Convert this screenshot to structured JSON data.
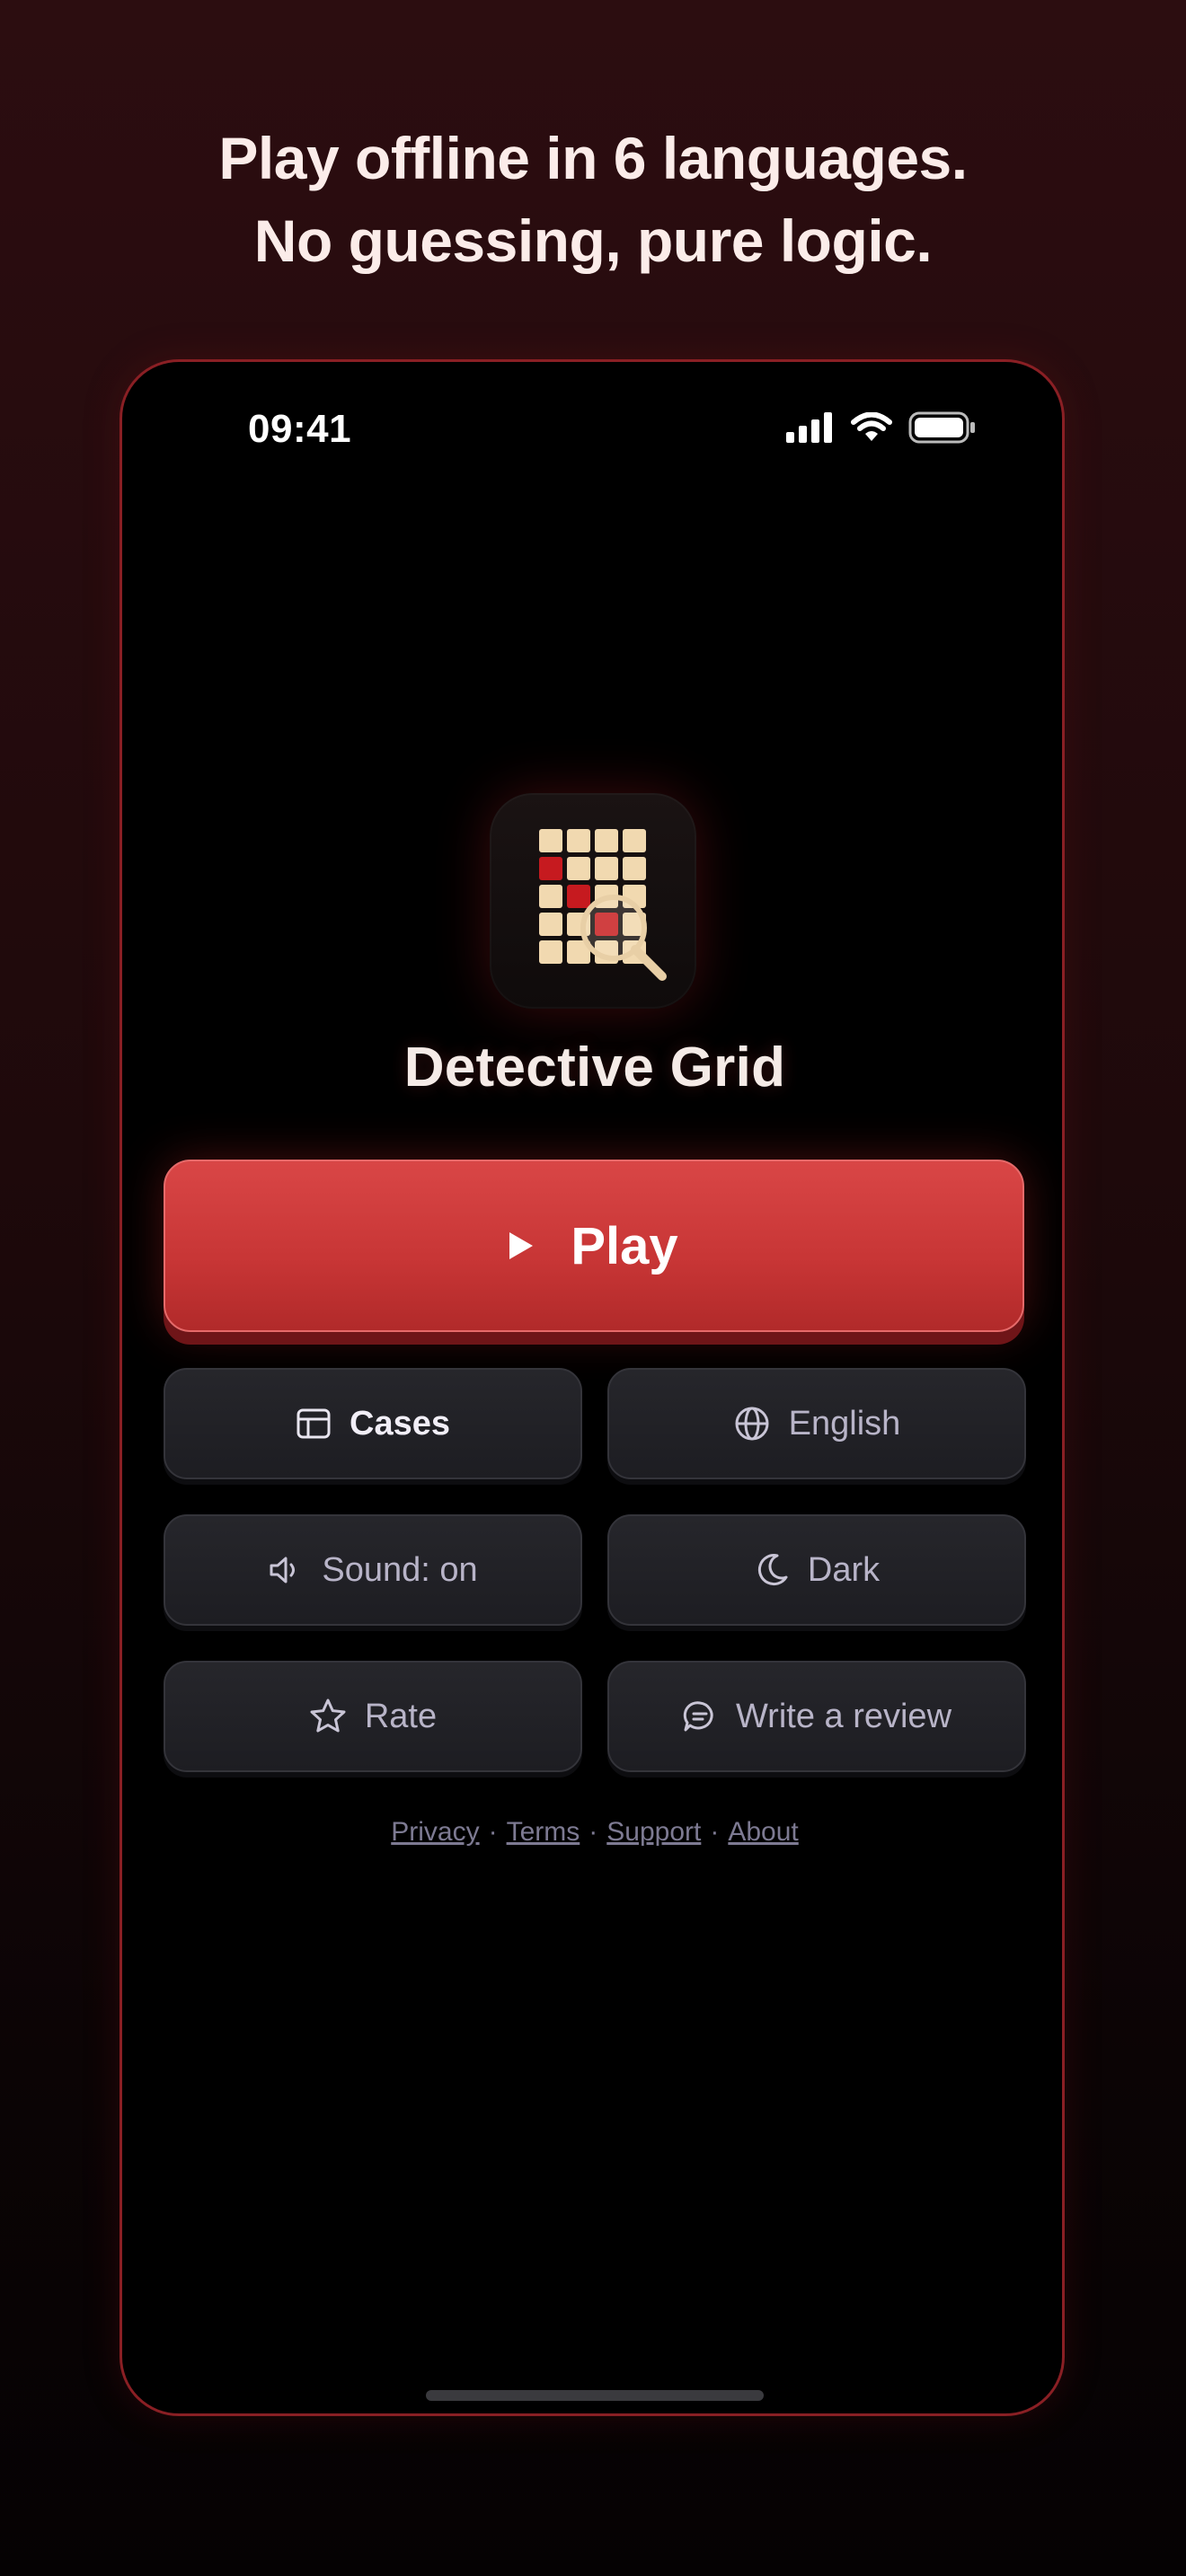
{
  "headline": {
    "line1": "Play offline in 6 languages.",
    "line2": "No guessing, pure logic."
  },
  "status_bar": {
    "time": "09:41",
    "icons": [
      "cellular-signal-icon",
      "wifi-icon",
      "battery-icon"
    ]
  },
  "app": {
    "title": "Detective Grid",
    "icon": "grid-magnifier-icon"
  },
  "buttons": {
    "play": "Play",
    "cases": "Cases",
    "language": "English",
    "sound": "Sound: on",
    "theme": "Dark",
    "rate": "Rate",
    "review": "Write a review"
  },
  "footer": {
    "links": [
      "Privacy",
      "Terms",
      "Support",
      "About"
    ],
    "separator": "·"
  },
  "colors": {
    "accent_red": "#d94646",
    "background_top": "#2c0d10",
    "frame_border": "#8a1f24",
    "muted_text": "#b8b4c8"
  }
}
